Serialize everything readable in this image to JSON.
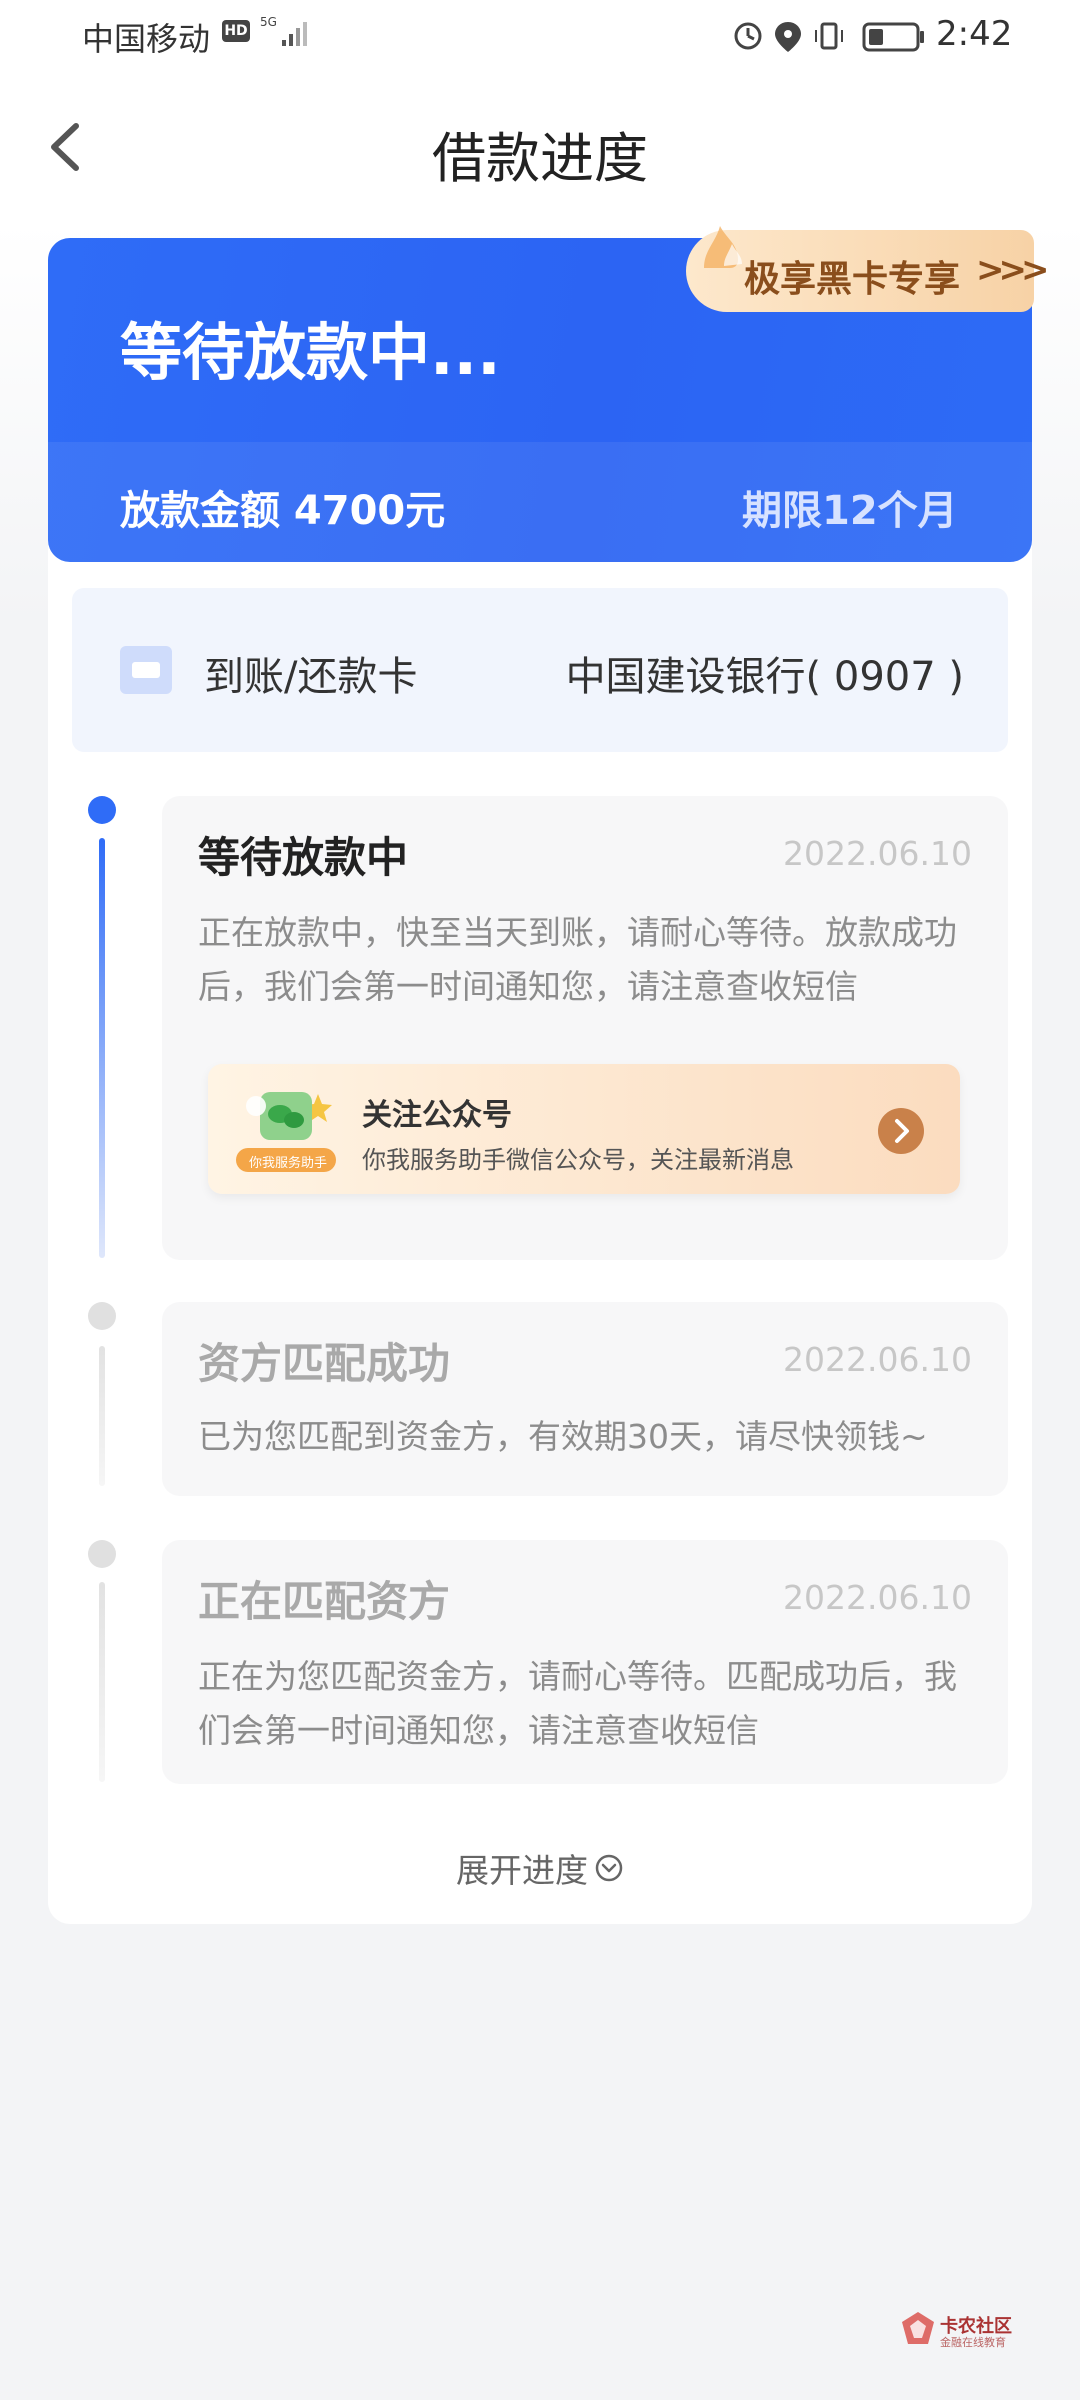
{
  "status_bar": {
    "carrier": "中国移动",
    "hd": "HD",
    "network": "5G",
    "time": "2:42"
  },
  "header": {
    "title": "借款进度"
  },
  "banner": {
    "status": "等待放款中...",
    "amount_label": "放款金额 4700元",
    "term_label": "期限12个月",
    "vip_badge": "极享黑卡专享",
    "vip_chevrons": ">>>"
  },
  "card": {
    "label": "到账/还款卡",
    "bank": "中国建设银行( 0907 )"
  },
  "steps": [
    {
      "title": "等待放款中",
      "date": "2022.06.10",
      "desc_line1": "正在放款中，快至当天到账，请耐心等待。放款成功",
      "desc_line2": "后，我们会第一时间通知您，请注意查收短信"
    },
    {
      "title": "资方匹配成功",
      "date": "2022.06.10",
      "desc_line1": "已为您匹配到资金方，有效期30天，请尽快领钱~"
    },
    {
      "title": "正在匹配资方",
      "date": "2022.06.10",
      "desc_line1": "正在为您匹配资金方，请耐心等待。匹配成功后，我",
      "desc_line2": "们会第一时间通知您，请注意查收短信"
    }
  ],
  "wechat": {
    "title": "关注公众号",
    "subtitle": "你我服务助手微信公众号，关注最新消息",
    "tag": "你我服务助手"
  },
  "expand": {
    "label": "展开进度"
  },
  "watermark": {
    "main": "卡农社区",
    "sub": "金融在线教育"
  },
  "colors": {
    "primary_blue": "#2f6cf7",
    "vip_gold": "#8a4e1c",
    "step_date_gray": "#c7c7c7"
  }
}
